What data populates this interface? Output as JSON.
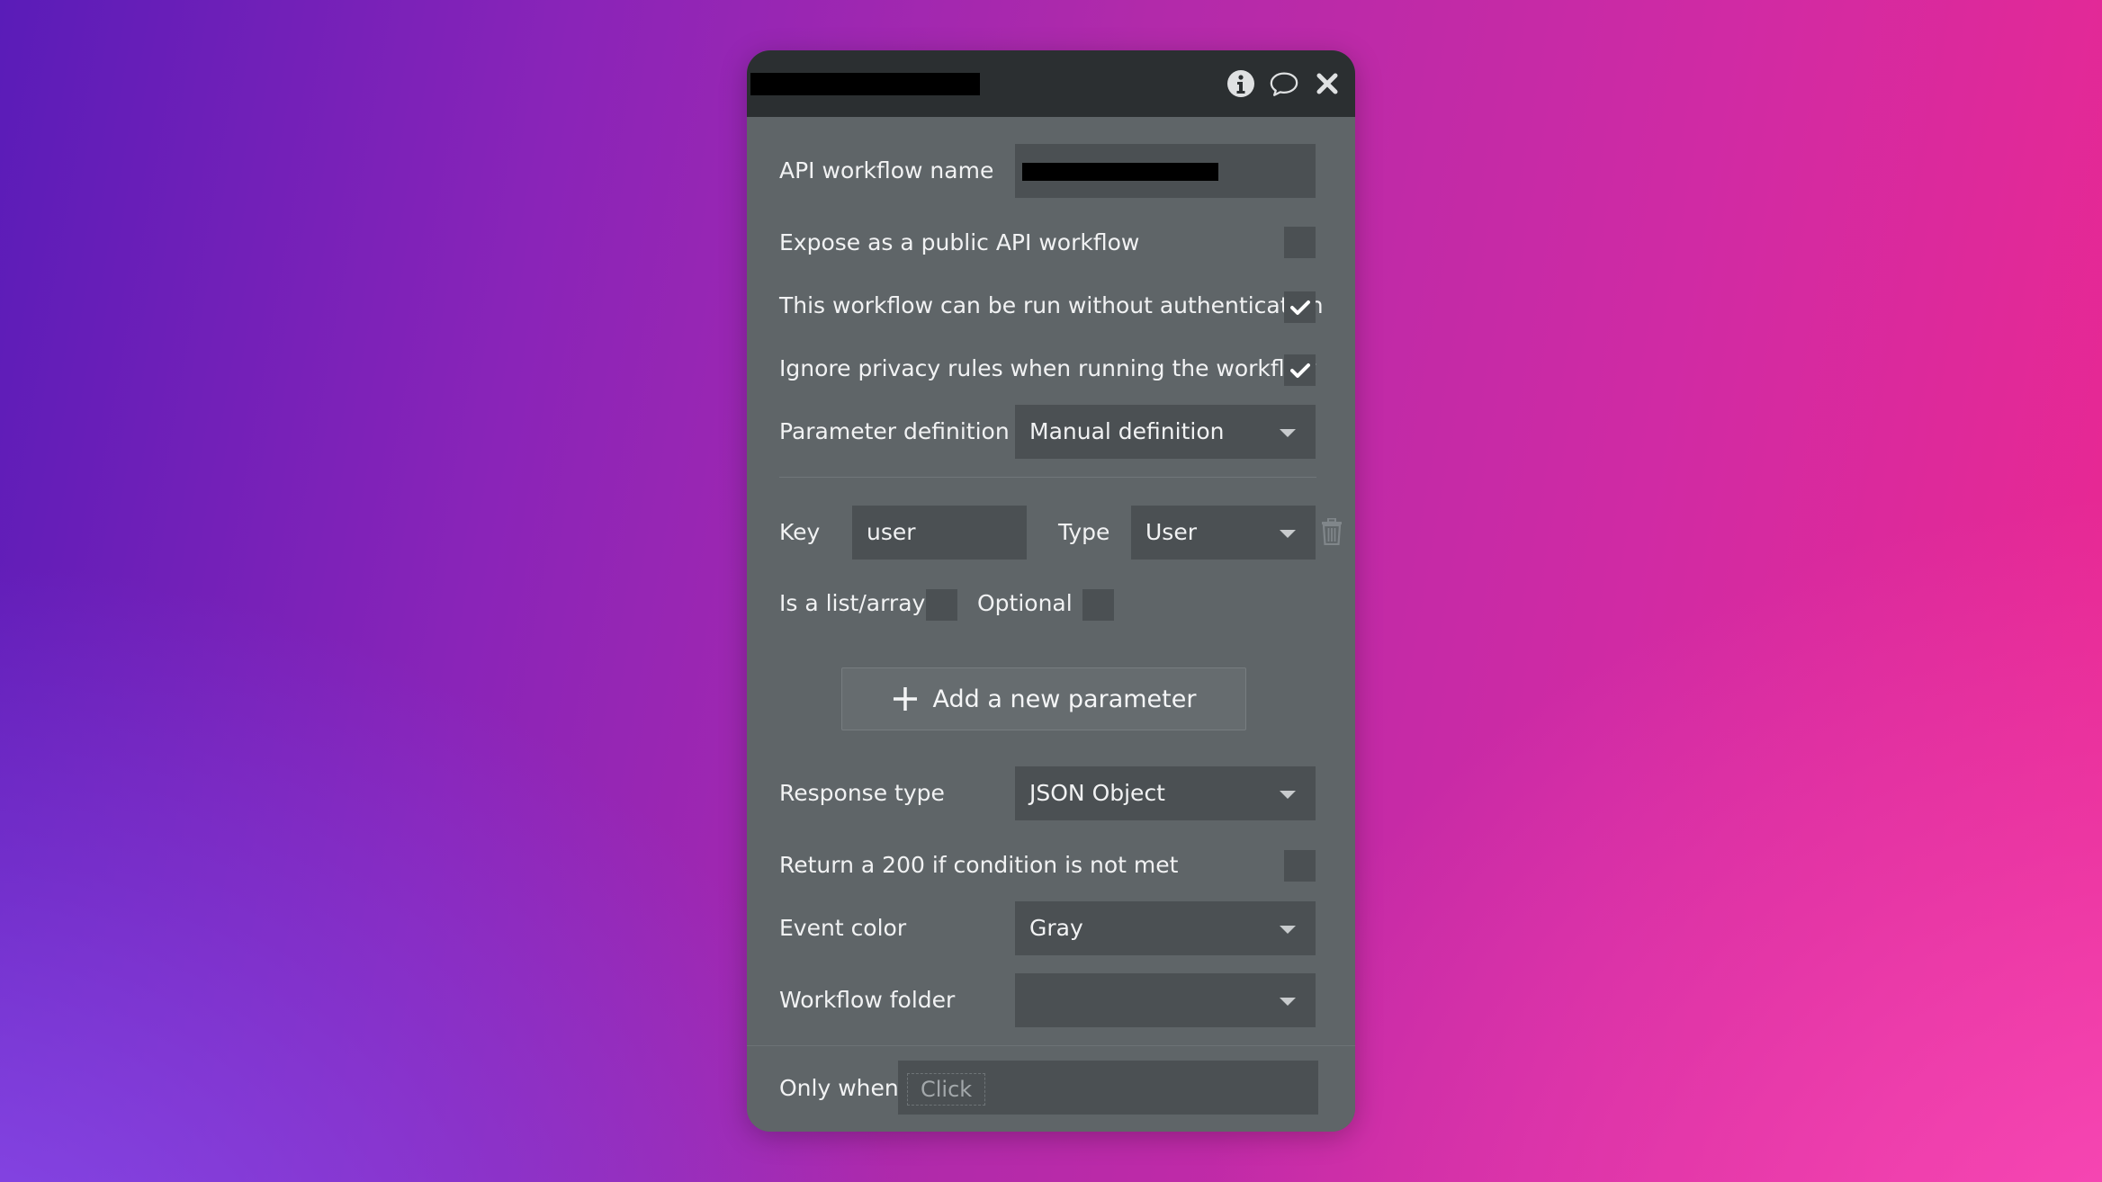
{
  "dialog": {
    "title_redacted": true,
    "icons": [
      "info-icon",
      "comment-icon",
      "close-icon"
    ]
  },
  "fields": {
    "workflow_name_label": "API workflow name",
    "expose_label": "Expose as a public API workflow",
    "expose_checked": false,
    "no_auth_label": "This workflow can be run without authentication",
    "no_auth_checked": true,
    "ignore_privacy_label": "Ignore privacy rules when running the workflow",
    "ignore_privacy_checked": true,
    "param_def_label": "Parameter definition",
    "param_def_value": "Manual definition"
  },
  "parameter": {
    "key_label": "Key",
    "key_value": "user",
    "type_label": "Type",
    "type_value": "User",
    "is_list_label": "Is a list/array",
    "is_list_checked": false,
    "optional_label": "Optional",
    "optional_checked": false
  },
  "add_parameter_label": "Add a new parameter",
  "response": {
    "response_type_label": "Response type",
    "response_type_value": "JSON Object",
    "return_200_label": "Return a 200 if condition is not met",
    "return_200_checked": false,
    "event_color_label": "Event color",
    "event_color_value": "Gray",
    "workflow_folder_label": "Workflow folder",
    "workflow_folder_value": ""
  },
  "condition": {
    "only_when_label": "Only when",
    "placeholder": "Click"
  }
}
